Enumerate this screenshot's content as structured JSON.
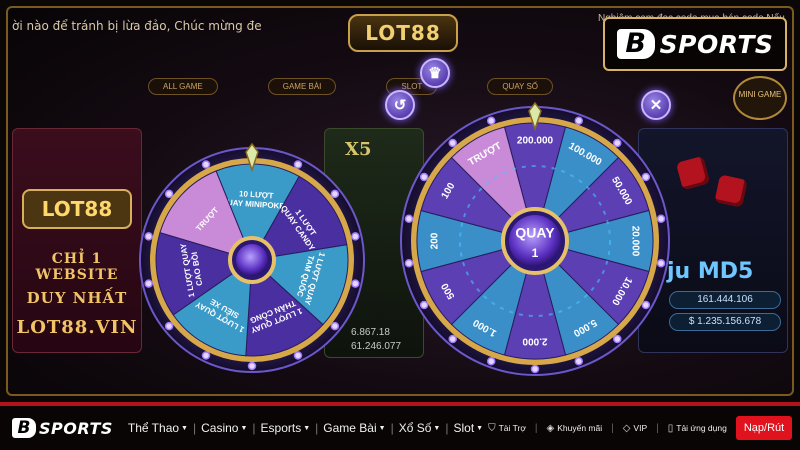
{
  "hud": {
    "marquee": "ời nào để tránh bị lừa đảo,  Chúc mừng  đe",
    "logo": "LOT88",
    "note": "Nghiệm cam đọc code mua bán code Nếu",
    "tabs": [
      "ALL GAME",
      "GAME BÀI",
      "SLOT",
      "QUAY SỐ"
    ],
    "mini_game": "MINI GAME"
  },
  "cards": {
    "lot88": {
      "logo": "LOT88",
      "line1": "CHỈ 1 WEBSITE",
      "line2": "DUY NHẤT",
      "line3": "LOT88.VIN"
    },
    "x5": {
      "title": "X5",
      "num1": "6.867.18",
      "num2": "61.246.077"
    },
    "md5": {
      "title": "ju MD5",
      "val1": "161.444.106",
      "val2": "$ 1.235.156.678"
    }
  },
  "small_wheel": {
    "center_label": "",
    "segments": [
      "10 LƯỢT QUAY MINIPOKER",
      "1 LƯỢT QUAY CANDY",
      "1 LƯỢT QUAY TAM QUỐC",
      "1 LƯỢT QUAY THẦN CÔNG",
      "1 LƯỢT QUAY SIÊU XE",
      "1 LƯỢT QUAY CAO BỒI",
      "TRƯỢT"
    ]
  },
  "big_wheel": {
    "center_label": "QUAY",
    "center_count": "1",
    "segments": [
      "200.000",
      "100.000",
      "50.000",
      "20.000",
      "10.000",
      "5.000",
      "2.000",
      "1.000",
      "500",
      "200",
      "100",
      "TRƯỢT"
    ]
  },
  "controls": {
    "history_icon": "history-icon",
    "trophy_icon": "trophy-icon",
    "close_icon": "close-icon"
  },
  "brand": {
    "mark": "B",
    "word": "SPORTS"
  },
  "navbar": {
    "logo_mark": "B",
    "logo_word": "SPORTS",
    "items": [
      "Thể Thao",
      "Casino",
      "Esports",
      "Game Bài",
      "Xổ Số",
      "Slot"
    ],
    "links": [
      "Tài Trợ",
      "Khuyến mãi",
      "VIP",
      "Tải ứng dụng"
    ],
    "cta": "Nạp/Rút"
  },
  "colors": {
    "accent_red": "#e0121e",
    "gold": "#d9b365",
    "wheel_purple": "#5b3fb3",
    "wheel_blue": "#3a8fc9",
    "wheel_pink": "#c58ad6"
  }
}
